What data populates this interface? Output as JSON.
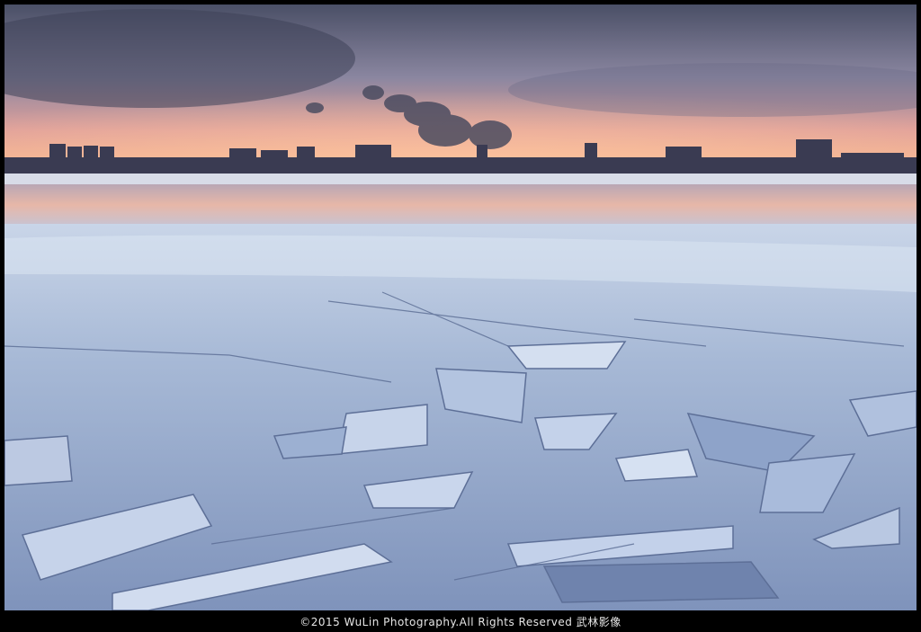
{
  "photo": {
    "subject": "frozen-river-at-dawn",
    "palette": {
      "sky_top": "#4a4f66",
      "sky_glow": "#f3a98a",
      "horizon": "#f6b58f",
      "water": "#e7b7a8",
      "ice_light": "#dbe6f3",
      "ice_mid": "#9fb3d3",
      "ice_shadow": "#4d5f86"
    }
  },
  "caption": {
    "text": "©2015  WuLin  Photography.All  Rights  Reserved   武林影像"
  }
}
